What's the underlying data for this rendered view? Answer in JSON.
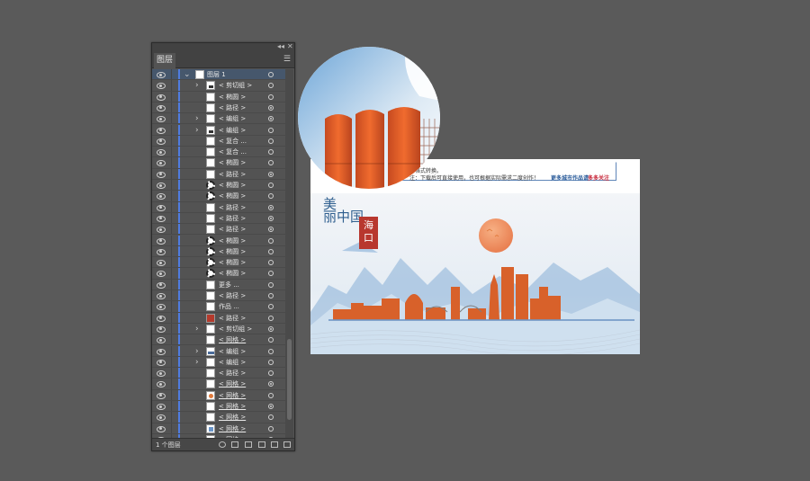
{
  "panel": {
    "tab_label": "图层",
    "collapse_glyph": "◂◂",
    "close_glyph": "✕",
    "menu_glyph": "☰",
    "layer_count_label": "1 个图层",
    "top_layer_name": "图层 1",
    "layers": [
      {
        "name": "< 剪切组 >",
        "expand": true,
        "thumb": "dark",
        "target_filled": false,
        "underline": false
      },
      {
        "name": "< 椭圆 >",
        "expand": false,
        "thumb": "plain",
        "target_filled": false,
        "underline": false
      },
      {
        "name": "< 路径 >",
        "expand": false,
        "thumb": "plain",
        "target_filled": true,
        "underline": false
      },
      {
        "name": "< 编组 >",
        "expand": true,
        "thumb": "plain",
        "target_filled": true,
        "underline": false
      },
      {
        "name": "< 编组 >",
        "expand": true,
        "thumb": "dark",
        "target_filled": false,
        "underline": false
      },
      {
        "name": "< 复合 ...",
        "expand": false,
        "thumb": "plain",
        "target_filled": false,
        "underline": false
      },
      {
        "name": "< 复合 ...",
        "expand": false,
        "thumb": "plain",
        "target_filled": false,
        "underline": false
      },
      {
        "name": "< 椭圆 >",
        "expand": false,
        "thumb": "plain",
        "target_filled": false,
        "underline": false
      },
      {
        "name": "< 路径 >",
        "expand": false,
        "thumb": "plain",
        "target_filled": true,
        "underline": false
      },
      {
        "name": "< 椭圆 >",
        "expand": false,
        "thumb": "circle",
        "target_filled": false,
        "underline": false
      },
      {
        "name": "< 椭圆 >",
        "expand": false,
        "thumb": "circle",
        "target_filled": false,
        "underline": false
      },
      {
        "name": "< 路径 >",
        "expand": false,
        "thumb": "plain",
        "target_filled": true,
        "underline": false
      },
      {
        "name": "< 路径 >",
        "expand": false,
        "thumb": "plain",
        "target_filled": true,
        "underline": false
      },
      {
        "name": "< 路径 >",
        "expand": false,
        "thumb": "plain",
        "target_filled": true,
        "underline": false
      },
      {
        "name": "< 椭圆 >",
        "expand": false,
        "thumb": "circle",
        "target_filled": false,
        "underline": false
      },
      {
        "name": "< 椭圆 >",
        "expand": false,
        "thumb": "circle",
        "target_filled": false,
        "underline": false
      },
      {
        "name": "< 椭圆 >",
        "expand": false,
        "thumb": "circle",
        "target_filled": false,
        "underline": false
      },
      {
        "name": "< 椭圆 >",
        "expand": false,
        "thumb": "circle",
        "target_filled": false,
        "underline": false
      },
      {
        "name": "更多 ...",
        "expand": false,
        "thumb": "plain",
        "target_filled": false,
        "underline": false
      },
      {
        "name": "< 路径 >",
        "expand": false,
        "thumb": "plain",
        "target_filled": false,
        "underline": false
      },
      {
        "name": "作品 ...",
        "expand": false,
        "thumb": "plain",
        "target_filled": false,
        "underline": false
      },
      {
        "name": "< 路径 >",
        "expand": false,
        "thumb": "red",
        "target_filled": false,
        "underline": false
      },
      {
        "name": "< 剪切组 >",
        "expand": true,
        "thumb": "plain",
        "target_filled": true,
        "underline": false
      },
      {
        "name": "< 网格 >",
        "expand": false,
        "thumb": "plain",
        "target_filled": false,
        "underline": true
      },
      {
        "name": "< 编组 >",
        "expand": true,
        "thumb": "skyline",
        "target_filled": false,
        "underline": false
      },
      {
        "name": "< 编组 >",
        "expand": true,
        "thumb": "plain",
        "target_filled": false,
        "underline": false
      },
      {
        "name": "< 路径 >",
        "expand": false,
        "thumb": "plain",
        "target_filled": false,
        "underline": false
      },
      {
        "name": "< 网格 >",
        "expand": false,
        "thumb": "plain",
        "target_filled": true,
        "underline": true
      },
      {
        "name": "< 网格 >",
        "expand": false,
        "thumb": "orange",
        "target_filled": false,
        "underline": true
      },
      {
        "name": "< 网格 >",
        "expand": false,
        "thumb": "plain",
        "target_filled": true,
        "underline": true
      },
      {
        "name": "< 网格 >",
        "expand": false,
        "thumb": "plain",
        "target_filled": false,
        "underline": true
      },
      {
        "name": "< 网格 >",
        "expand": false,
        "thumb": "blue",
        "target_filled": false,
        "underline": true
      },
      {
        "name": "< 网格 >",
        "expand": false,
        "thumb": "plain",
        "target_filled": false,
        "underline": true
      }
    ]
  },
  "artboard": {
    "note_line1": "多格式转换。",
    "note_line2": "注：下载后可直接使用，也可根据实际需求二度创作！",
    "note_right_a": "更多城市作品请",
    "note_right_b": "多多关注",
    "title_line1": "美",
    "title_line2": "丽中国",
    "seal_text": "海口",
    "colors": {
      "accent_orange": "#e2622b",
      "mountain_blue": "#7aa6d3",
      "seal_red": "#b8372e",
      "layer_color_bar": "#4f7ce0"
    }
  }
}
